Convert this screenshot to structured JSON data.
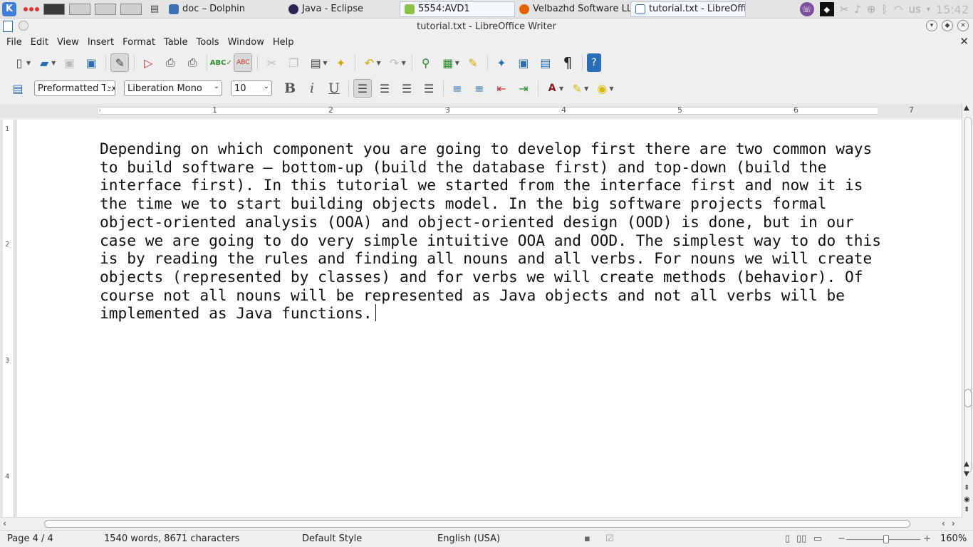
{
  "taskbar": {
    "tasks": [
      {
        "label": "doc – Dolphin",
        "icon": "folder-icon",
        "color": "#3b6fb6"
      },
      {
        "label": "Java - Eclipse",
        "icon": "eclipse-icon",
        "color": "#2c2255"
      },
      {
        "label": "5554:AVD1",
        "icon": "android-icon",
        "color": "#8bc34a"
      },
      {
        "label": "Velbazhd Software LLC",
        "icon": "firefox-icon",
        "color": "#e66000"
      },
      {
        "label": "tutorial.txt - LibreOffic",
        "icon": "writer-icon",
        "color": "#2a6fb5"
      }
    ],
    "keyboard_layout": "us",
    "clock": "15:42"
  },
  "window": {
    "title": "tutorial.txt - LibreOffice Writer"
  },
  "menu": [
    "File",
    "Edit",
    "View",
    "Insert",
    "Format",
    "Table",
    "Tools",
    "Window",
    "Help"
  ],
  "formatting": {
    "paragraph_style": "Preformatted Text",
    "font_name": "Liberation Mono",
    "font_size": "10",
    "bold": "B",
    "italic": "i",
    "underline": "U"
  },
  "ruler": {
    "h_labels": [
      "1",
      "2",
      "3",
      "4",
      "5",
      "6",
      "7"
    ],
    "v_labels": [
      "1",
      "2",
      "3",
      "4"
    ]
  },
  "document": {
    "text": "Depending on which component you are going to develop first there are two common ways to build software – bottom-up (build the database first) and top-down (build the interface first). In this tutorial we started from the interface first and now it is the time we to start building objects model. In the big software projects formal object-oriented analysis (OOA) and object-oriented design (OOD) is done, but in our case we are going to do very simple intuitive OOA and OOD. The simplest way to do this is by reading the rules and finding all nouns and all verbs. For nouns we will create objects (represented by classes) and for verbs we will create methods (behavior). Of course not all nouns will be represented as Java objects and not all verbs will be implemented as Java functions."
  },
  "status": {
    "page": "Page 4 / 4",
    "words": "1540 words, 8671 characters",
    "style": "Default Style",
    "language": "English (USA)",
    "zoom": "160%",
    "zoom_level": 160
  },
  "colors": {
    "accent": "#2a6fb5"
  }
}
